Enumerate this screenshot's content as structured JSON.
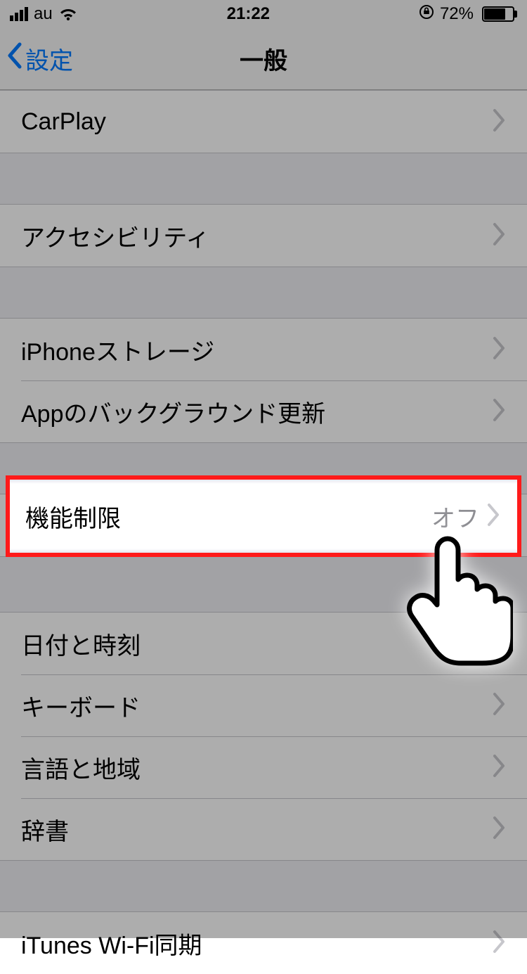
{
  "status": {
    "carrier": "au",
    "time": "21:22",
    "battery_pct": "72%"
  },
  "nav": {
    "back_label": "設定",
    "title": "一般"
  },
  "rows": {
    "carplay": "CarPlay",
    "accessibility": "アクセシビリティ",
    "iphone_storage": "iPhoneストレージ",
    "background_refresh": "Appのバックグラウンド更新",
    "restrictions": "機能制限",
    "restrictions_value": "オフ",
    "date_time": "日付と時刻",
    "keyboard": "キーボード",
    "language_region": "言語と地域",
    "dictionary": "辞書",
    "itunes_wifi_sync": "iTunes Wi-Fi同期"
  }
}
